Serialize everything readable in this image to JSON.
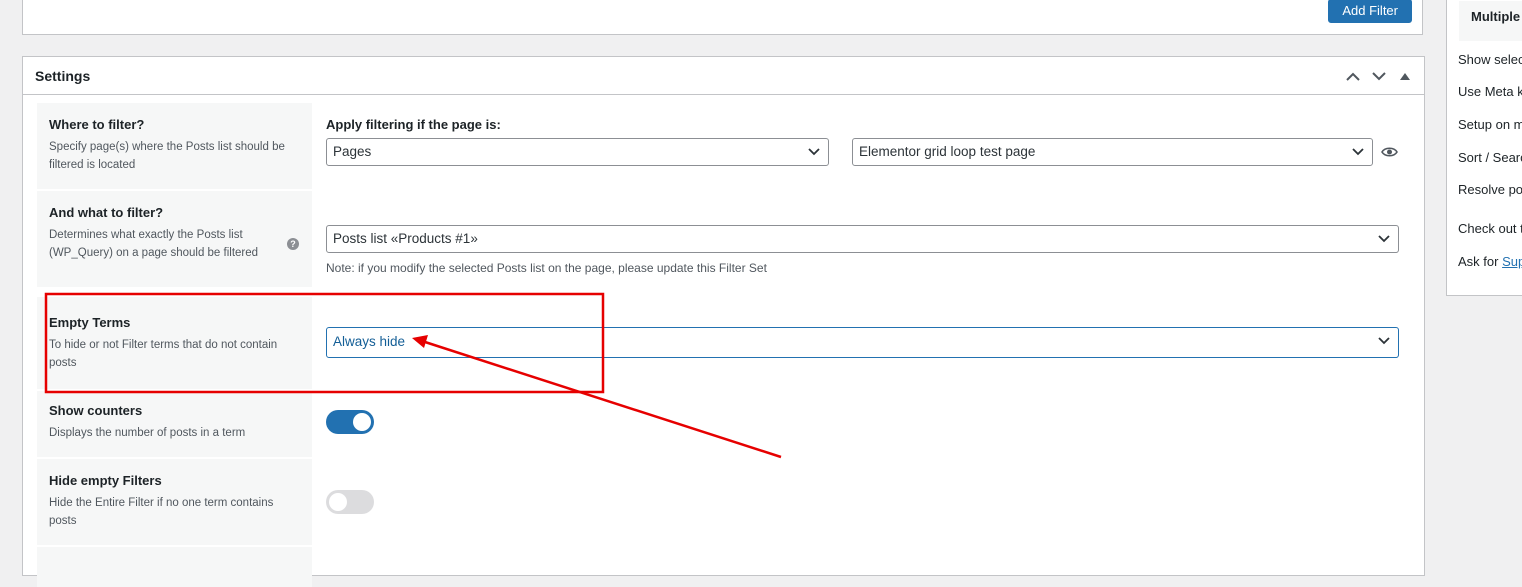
{
  "top_panel": {
    "add_filter_label": "Add Filter"
  },
  "settings": {
    "title": "Settings",
    "where": {
      "title": "Where to filter?",
      "desc": "Specify page(s) where the Posts list should be filtered is located",
      "apply_label": "Apply filtering if the page is:",
      "page_type_value": "Pages",
      "page_value": "Elementor grid loop test page"
    },
    "what": {
      "title": "And what to filter?",
      "desc": "Determines what exactly the Posts list (WP_Query) on a page should be filtered",
      "help_icon": "?",
      "posts_list_value": "Posts list «Products #1»",
      "note": "Note: if you modify the selected Posts list on the page, please update this Filter Set"
    },
    "empty_terms": {
      "title": "Empty Terms",
      "desc": "To hide or not Filter terms that do not contain posts",
      "value": "Always hide"
    },
    "show_counters": {
      "title": "Show counters",
      "desc": "Displays the number of posts in a term",
      "enabled": true
    },
    "hide_empty": {
      "title": "Hide empty Filters",
      "desc": "Hide the Entire Filter if no one term contains posts",
      "enabled": false
    }
  },
  "sidebar": {
    "head": "Multiple",
    "items": [
      "Show selec",
      "Use Meta k",
      "Setup on m",
      "Sort / Searc",
      "Resolve pop",
      "Check out t"
    ],
    "ask_prefix": "Ask for ",
    "ask_link": "Sup"
  },
  "colors": {
    "accent": "#2271b1",
    "annotation": "#e60000"
  },
  "icons": [
    "chevron-up-icon",
    "chevron-down-icon",
    "triangle-up-icon",
    "eye-icon",
    "help-icon",
    "dropdown-chevron-icon"
  ]
}
